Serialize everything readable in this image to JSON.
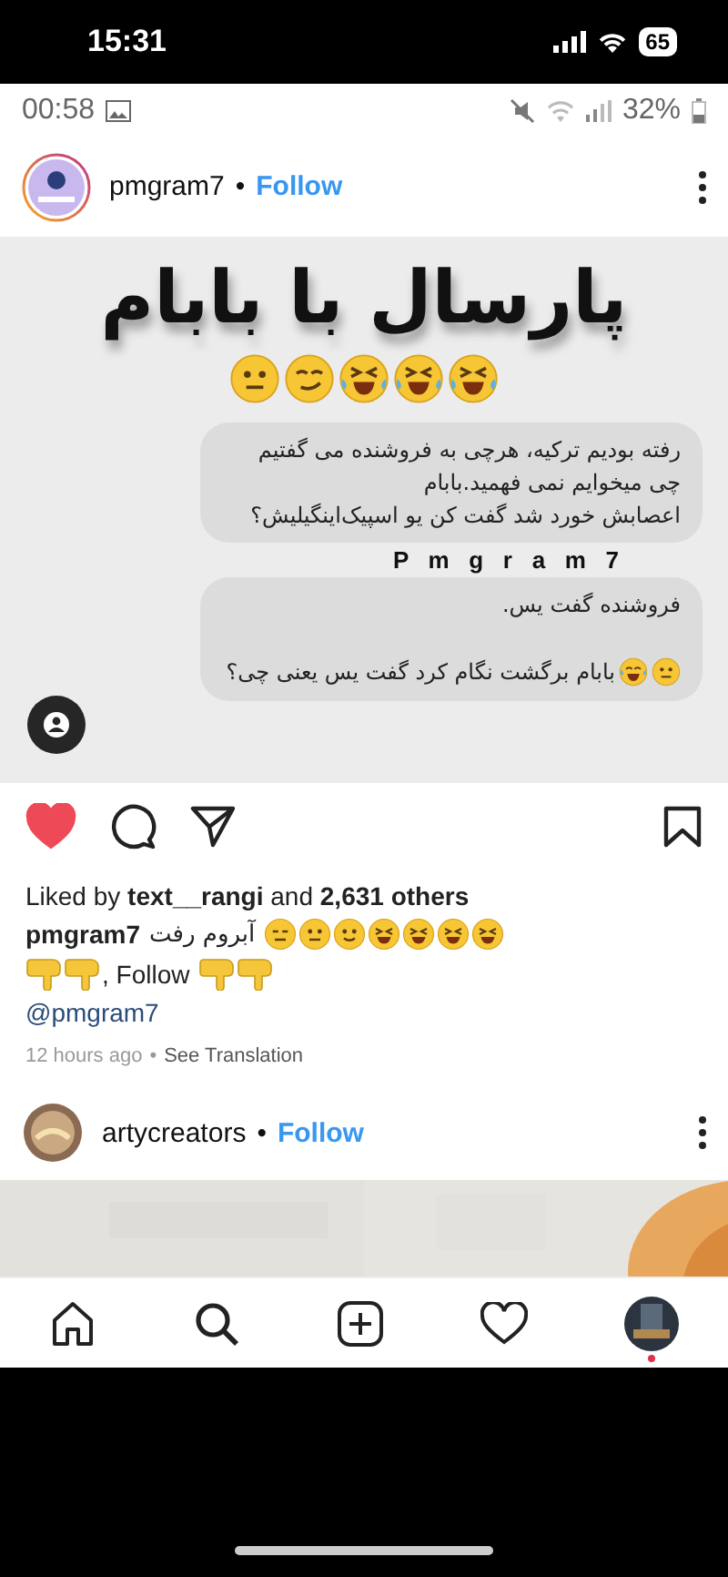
{
  "ios_status": {
    "time": "15:31",
    "battery": "65"
  },
  "android_status": {
    "time": "00:58",
    "battery": "32%"
  },
  "post": {
    "username": "pmgram7",
    "separator": "•",
    "follow": "Follow",
    "image": {
      "title": "پارسال با بابام",
      "title_emojis": [
        {
          "kind": "neutral"
        },
        {
          "kind": "smirk"
        },
        {
          "kind": "rofl"
        },
        {
          "kind": "rofl"
        },
        {
          "kind": "rofl"
        }
      ],
      "bubbles": [
        {
          "lines": [
            "رفته بودیم ترکیه، هرچی به فروشنده می گفتیم",
            "چی میخوایم نمی فهمید.بابام",
            "اعصابش خورد  شد گفت کن یو اسپیک‌اینگیلیش؟"
          ]
        },
        {
          "lines": [
            "فروشنده گفت یس.",
            "بابام برگشت نگام کرد گفت یس یعنی چی؟"
          ],
          "emojis": [
            {
              "kind": "neutral"
            },
            {
              "kind": "joy"
            }
          ]
        }
      ],
      "signature": "P   m   g   r   a   m   7"
    },
    "liked": true,
    "saved": false,
    "likes": "Liked by **text__rangi** and **2,631 others**",
    "caption_user": "pmgram7",
    "caption_text": "آبروم رفت",
    "caption_emojis": [
      {
        "kind": "expressionless"
      },
      {
        "kind": "neutral"
      },
      {
        "kind": "slight"
      },
      {
        "kind": "laugh"
      },
      {
        "kind": "laugh"
      },
      {
        "kind": "laugh"
      },
      {
        "kind": "laugh"
      }
    ],
    "follow_line": ", Follow",
    "mention": "@pmgram7",
    "time": "12 hours ago",
    "meta_separator": "•",
    "translation": "See Translation"
  },
  "next_post": {
    "username": "artycreators",
    "separator": "•",
    "follow": "Follow"
  },
  "nav": [
    {
      "kind": "home"
    },
    {
      "kind": "search"
    },
    {
      "kind": "add"
    },
    {
      "kind": "activity"
    },
    {
      "kind": "profile",
      "notification": true
    }
  ]
}
